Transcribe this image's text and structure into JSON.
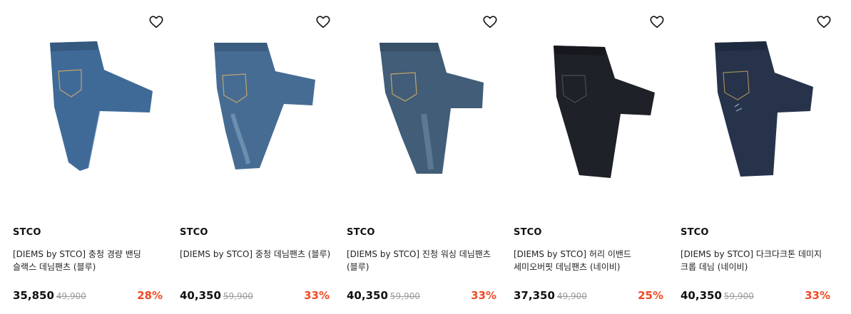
{
  "colors": {
    "discount": "#ef4a23",
    "original_price": "#9a9a9a",
    "jeans_blue": "#3f6a98",
    "jeans_mid_blue": "#466c93",
    "jeans_washed": "#415d78",
    "jeans_black": "#1f2128",
    "jeans_navy": "#26334b"
  },
  "products": [
    {
      "brand": "STCO",
      "name": "[DIEMS by STCO] 충청 경량 밴딩 슬랙스 데님팬츠 (블루)",
      "price": "35,850",
      "original_price": "49,900",
      "discount": "28%",
      "wishlist_icon": "heart-outline-icon",
      "image": "blue-jeans"
    },
    {
      "brand": "STCO",
      "name": "[DIEMS by STCO] 중청 데님팬츠 (블루)",
      "price": "40,350",
      "original_price": "59,900",
      "discount": "33%",
      "wishlist_icon": "heart-outline-icon",
      "image": "mid-blue-jeans"
    },
    {
      "brand": "STCO",
      "name": "[DIEMS by STCO] 진청 워싱 데님팬츠 (블루)",
      "price": "40,350",
      "original_price": "59,900",
      "discount": "33%",
      "wishlist_icon": "heart-outline-icon",
      "image": "washed-dark-jeans"
    },
    {
      "brand": "STCO",
      "name": "[DIEMS by STCO] 허리 이밴드 세미오버핏 데님팬츠 (네이비)",
      "price": "37,350",
      "original_price": "49,900",
      "discount": "25%",
      "wishlist_icon": "heart-outline-icon",
      "image": "black-jeans"
    },
    {
      "brand": "STCO",
      "name": "[DIEMS by STCO] 다크다크톤 데미지 크롭 데님 (네이비)",
      "price": "40,350",
      "original_price": "59,900",
      "discount": "33%",
      "wishlist_icon": "heart-outline-icon",
      "image": "navy-jeans"
    }
  ]
}
